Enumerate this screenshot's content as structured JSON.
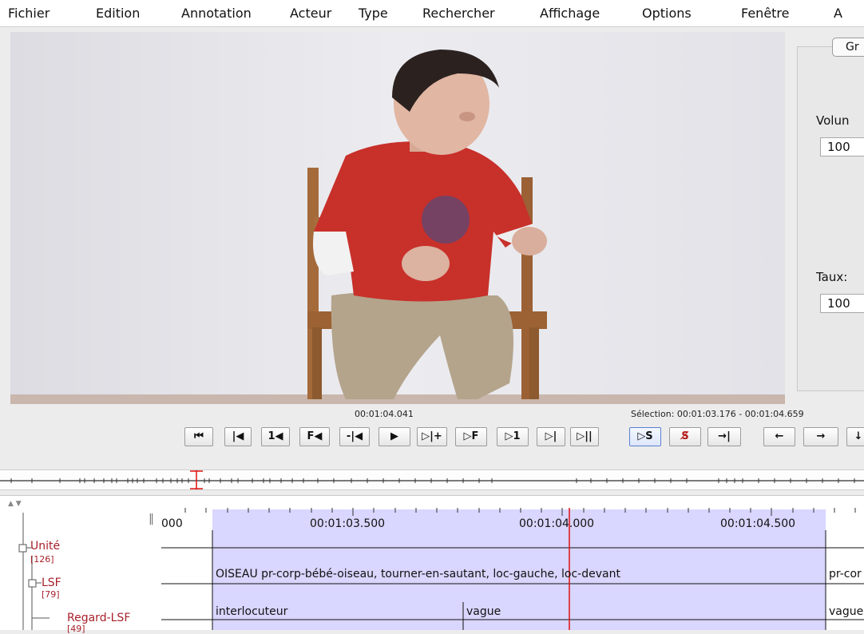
{
  "menu": {
    "items": [
      "Fichier",
      "Edition",
      "Annotation",
      "Acteur",
      "Type",
      "Rechercher",
      "Affichage",
      "Options",
      "Fenêtre",
      "A"
    ]
  },
  "side_panel": {
    "tab_label": "Gr",
    "volume_label": "Volun",
    "volume_value": "100",
    "rate_label": "Taux:",
    "rate_value": "100"
  },
  "player": {
    "current_time": "00:01:04.041",
    "selection": "Sélection: 00:01:03.176 - 00:01:04.659",
    "controls": [
      "⏮",
      "|◀",
      "1◀",
      "F◀",
      "-|◀",
      "▶",
      "▷|+",
      "▷F",
      "▷1",
      "▷|",
      "▷||"
    ],
    "selection_controls": [
      "▷S",
      "S̸",
      "→|"
    ],
    "nav_controls": [
      "←",
      "→",
      "↓"
    ]
  },
  "timeline": {
    "ruler": {
      "labels": [
        "000",
        "00:01:03.500",
        "00:01:04.000",
        "00:01:04.500"
      ]
    },
    "tiers": [
      {
        "name": "Unité",
        "count": "[126]"
      },
      {
        "name": "LSF",
        "count": "[79]"
      },
      {
        "name": "Regard-LSF",
        "count": "[49]"
      }
    ],
    "annotations": {
      "lsf_main": "OISEAU pr-corp-bébé-oiseau, tourner-en-sautant, loc-gauche, loc-devant",
      "lsf_next": "pr-cor",
      "regard_1": "interlocuteur",
      "regard_2": "vague",
      "regard_3": "vague"
    }
  },
  "colors": {
    "selection": "#d9d6ff",
    "crosshair": "#e01010",
    "tier_name": "#a8202a"
  }
}
